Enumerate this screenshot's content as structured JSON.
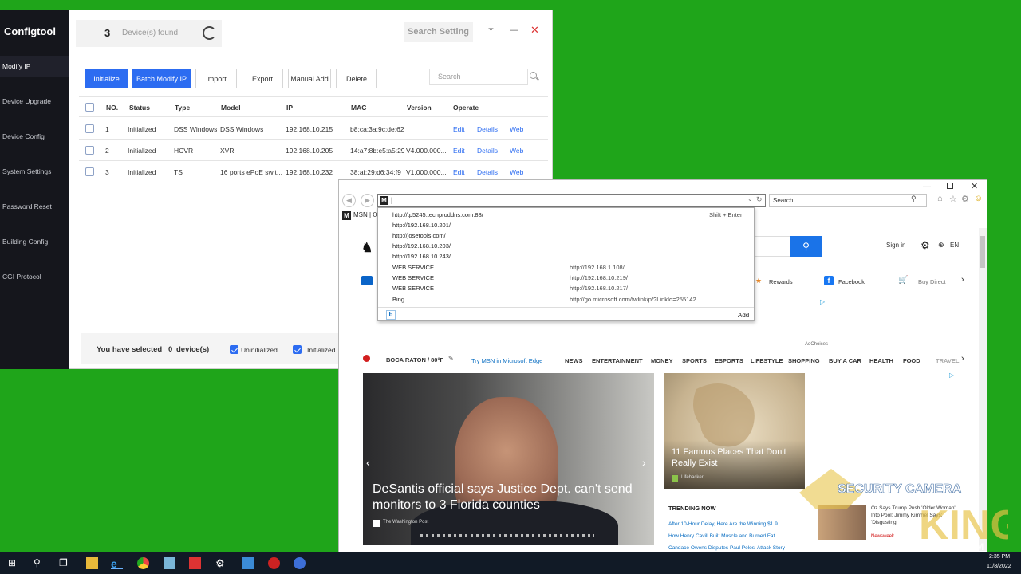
{
  "configtool": {
    "app_title": "Configtool",
    "sidebar": [
      "Modify IP",
      "Device Upgrade",
      "Device Config",
      "System Settings",
      "Password Reset",
      "Building Config",
      "CGI Protocol"
    ],
    "device_count": "3",
    "devices_found_label": "Device(s) found",
    "search_setting": "Search Setting",
    "toolbar": {
      "initialize": "Initialize",
      "batch_modify": "Batch Modify IP",
      "import": "Import",
      "export": "Export",
      "manual_add": "Manual Add",
      "delete": "Delete"
    },
    "search_placeholder": "Search",
    "columns": [
      "NO.",
      "Status",
      "Type",
      "Model",
      "IP",
      "MAC",
      "Version",
      "Operate"
    ],
    "rows": [
      {
        "no": "1",
        "status": "Initialized",
        "type": "DSS Windows",
        "model": "DSS Windows",
        "ip": "192.168.10.215",
        "mac": "b8:ca:3a:9c:de:62",
        "version": "",
        "ops": [
          "Edit",
          "Details",
          "Web"
        ]
      },
      {
        "no": "2",
        "status": "Initialized",
        "type": "HCVR",
        "model": "XVR",
        "ip": "192.168.10.205",
        "mac": "14:a7:8b:e5:a5:29",
        "version": "V4.000.000...",
        "ops": [
          "Edit",
          "Details",
          "Web"
        ]
      },
      {
        "no": "3",
        "status": "Initialized",
        "type": "TS",
        "model": "16 ports ePoE swit...",
        "ip": "192.168.10.232",
        "mac": "38:af:29:d6:34:f9",
        "version": "V1.000.000...",
        "ops": [
          "Edit",
          "Details",
          "Web"
        ]
      }
    ],
    "selected_text_prefix": "You have selected",
    "selected_count": "0",
    "selected_text_suffix": "device(s)",
    "filter_uninitialized": "Uninitialized",
    "filter_initialized": "Initialized"
  },
  "ie": {
    "address_value": "|",
    "search_placeholder": "Search...",
    "tab_label": "MSN | O",
    "suggestions": [
      {
        "url": "http://tp5245.techproddns.com:88/",
        "right": "Shift + Enter"
      },
      {
        "url": "http://192.168.10.201/",
        "right": ""
      },
      {
        "url": "http://josetools.com/",
        "right": ""
      },
      {
        "url": "http://192.168.10.203/",
        "right": ""
      },
      {
        "url": "http://192.168.10.243/",
        "right": ""
      },
      {
        "url": "WEB SERVICE",
        "right": "http://192.168.1.108/"
      },
      {
        "url": "WEB SERVICE",
        "right": "http://192.168.10.219/"
      },
      {
        "url": "WEB SERVICE",
        "right": "http://192.168.10.217/"
      },
      {
        "url": "Bing",
        "right": "http://go.microsoft.com/fwlink/p/?LinkId=255142"
      }
    ],
    "add_label": "Add",
    "msn": {
      "sign_in": "Sign in",
      "lang": "EN",
      "quick_links": [
        "Rewards",
        "Facebook",
        "Buy Direct"
      ],
      "ad_choices": "AdChoices",
      "location": "BOCA RATON / 80°F",
      "try_edge": "Try MSN in Microsoft Edge",
      "nav": [
        "NEWS",
        "ENTERTAINMENT",
        "MONEY",
        "SPORTS",
        "ESPORTS",
        "LIFESTYLE",
        "SHOPPING",
        "BUY A CAR",
        "HEALTH",
        "FOOD",
        "TRAVEL"
      ],
      "hero_title": "DeSantis official says Justice Dept. can't send monitors to 3 Florida counties",
      "hero_source": "The Washington Post",
      "card_title": "11 Famous Places That Don't Really Exist",
      "card_source": "Lifehacker",
      "trending_label": "TRENDING NOW",
      "trending": [
        "After 10-Hour Delay, Here Are the Winning $1.9...",
        "How Henry Cavill Built Muscle and Burned Fat...",
        "Candace Owens Disputes Paul Pelosi Attack Story"
      ],
      "promo_text": "Oz Says Trump Push 'Older Woman' Into Pool; Jimmy Kimmel Says: 'Disgusting'",
      "promo_source": "Newsweek"
    }
  },
  "watermark": "SECURITY CAMERA KING .COM",
  "taskbar": {
    "time": "2:35 PM",
    "date": "11/8/2022"
  }
}
